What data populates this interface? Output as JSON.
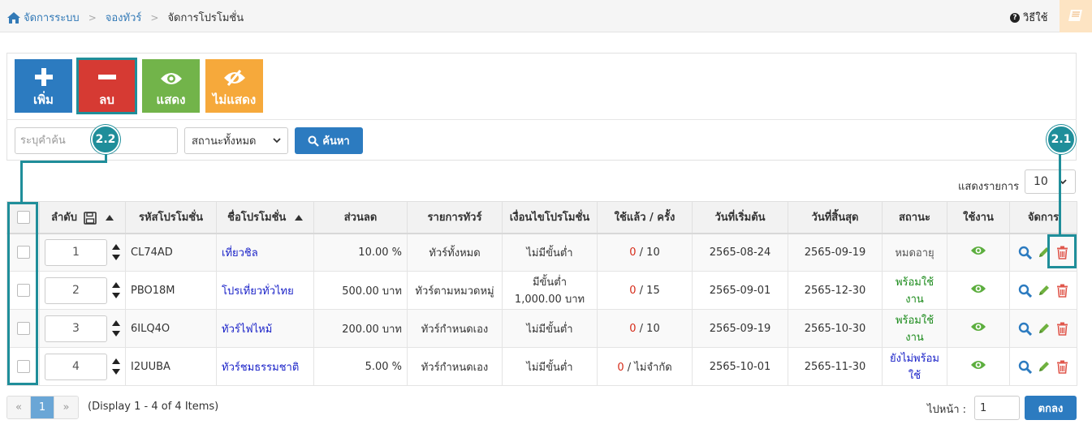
{
  "breadcrumb": {
    "home": "จัดการระบบ",
    "parent": "จองทัวร์",
    "current": "จัดการโปรโมชั่น"
  },
  "help": {
    "label": "วิธีใช้"
  },
  "toolbar": {
    "add_label": "เพิ่ม",
    "delete_label": "ลบ",
    "show_label": "แสดง",
    "hide_label": "ไม่แสดง"
  },
  "search": {
    "placeholder": "ระบุคำค้น",
    "status_value": "สถานะทั้งหมด",
    "button_label": "ค้นหา"
  },
  "annotations": {
    "delete_step": "2.2",
    "row_delete_step": "2.1"
  },
  "page_size": {
    "label": "แสดงรายการ",
    "value": "10"
  },
  "table": {
    "headers": {
      "order": "ลำดับ",
      "code": "รหัสโปรโมชั่น",
      "name": "ชื่อโปรโมชั่น",
      "discount": "ส่วนลด",
      "tour_items": "รายการทัวร์",
      "condition": "เงื่อนไขโปรโมชั่น",
      "used": "ใช้แล้ว / ครั้ง",
      "start": "วันที่เริ่มต้น",
      "end": "วันที่สิ้นสุด",
      "status": "สถานะ",
      "active": "ใช้งาน",
      "manage": "จัดการ"
    },
    "rows": [
      {
        "order": "1",
        "code": "CL74AD",
        "name": "เที่ยวชิล",
        "discount": "10.00 %",
        "tour_items": "ทัวร์ทั้งหมด",
        "condition": "ไม่มีขั้นต่ำ",
        "used": "0",
        "limit": "/ 10",
        "start": "2565-08-24",
        "end": "2565-09-19",
        "status": "หมดอายุ"
      },
      {
        "order": "2",
        "code": "PBO18M",
        "name": "โปรเที่ยวทั่วไทย",
        "discount": "500.00 บาท",
        "tour_items": "ทัวร์ตามหมวดหมู่",
        "condition": "มีขั้นต่ำ 1,000.00 บาท",
        "used": "0",
        "limit": "/ 15",
        "start": "2565-09-01",
        "end": "2565-12-30",
        "status": "พร้อมใช้งาน"
      },
      {
        "order": "3",
        "code": "6ILQ4O",
        "name": "ทัวร์ไฟไหม้",
        "discount": "200.00 บาท",
        "tour_items": "ทัวร์กำหนดเอง",
        "condition": "ไม่มีขั้นต่ำ",
        "used": "0",
        "limit": "/ 10",
        "start": "2565-09-19",
        "end": "2565-10-30",
        "status": "พร้อมใช้งาน"
      },
      {
        "order": "4",
        "code": "I2UUBA",
        "name": "ทัวร์ชมธรรมชาติ",
        "discount": "5.00 %",
        "tour_items": "ทัวร์กำหนดเอง",
        "condition": "ไม่มีขั้นต่ำ",
        "used": "0",
        "limit": "/ ไม่จำกัด",
        "start": "2565-10-01",
        "end": "2565-11-30",
        "status": "ยังไม่พร้อมใช้"
      }
    ]
  },
  "pagination": {
    "prev": "«",
    "current": "1",
    "next": "»",
    "display_text": "(Display 1 - 4 of 4 Items)",
    "goto_label": "ไปหน้า :",
    "goto_value": "1",
    "goto_button": "ตกลง"
  },
  "colors": {
    "primary": "#2c7bc0",
    "danger": "#d63a33",
    "success": "#72b44a",
    "warning": "#f6a93b",
    "annotation": "#1f8e9a"
  }
}
